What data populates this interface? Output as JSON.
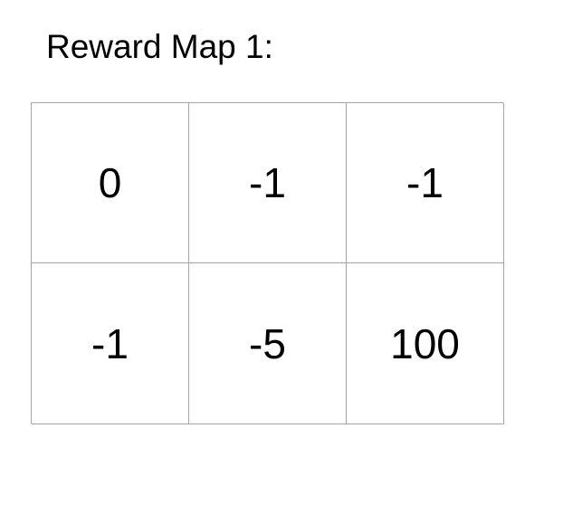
{
  "title": "Reward Map 1:",
  "grid": {
    "rows": [
      [
        "0",
        "-1",
        "-1"
      ],
      [
        "-1",
        "-5",
        "100"
      ]
    ]
  },
  "colors": {
    "border": "#a6a6a6",
    "text": "#000000",
    "background": "#ffffff"
  }
}
